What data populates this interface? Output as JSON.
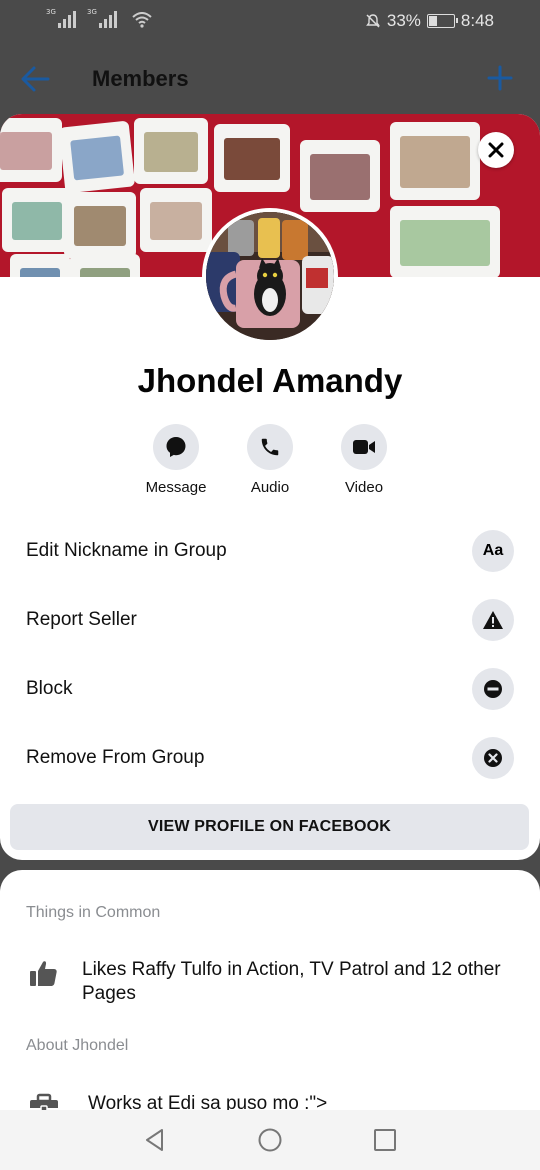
{
  "status_bar": {
    "signal1_label": "3G",
    "signal2_label": "3G",
    "battery_percent": "33%",
    "time": "8:48",
    "battery_level": 0.33
  },
  "app_bar": {
    "title": "Members"
  },
  "profile": {
    "name": "Jhondel Amandy",
    "actions": [
      {
        "label": "Message",
        "icon": "messenger-bubble-icon"
      },
      {
        "label": "Audio",
        "icon": "phone-icon"
      },
      {
        "label": "Video",
        "icon": "video-camera-icon"
      }
    ],
    "menu": [
      {
        "label": "Edit Nickname in Group",
        "icon": "text-aa-icon",
        "icon_text": "Aa"
      },
      {
        "label": "Report Seller",
        "icon": "warning-triangle-icon"
      },
      {
        "label": "Block",
        "icon": "block-minus-icon"
      },
      {
        "label": "Remove From Group",
        "icon": "remove-x-circle-icon"
      }
    ],
    "view_profile_label": "VIEW PROFILE ON FACEBOOK"
  },
  "sheet": {
    "things_title": "Things in Common",
    "likes_text": "Likes Raffy Tulfo in Action, TV Patrol and 12 other Pages",
    "about_title": "About Jhondel",
    "works_text": "Works at Edi sa puso mo :\">"
  },
  "colors": {
    "accent": "#1877f2",
    "cover_red": "#b3162a",
    "chip_gray": "#e4e6eb",
    "overlay": "#4a4a4a"
  }
}
